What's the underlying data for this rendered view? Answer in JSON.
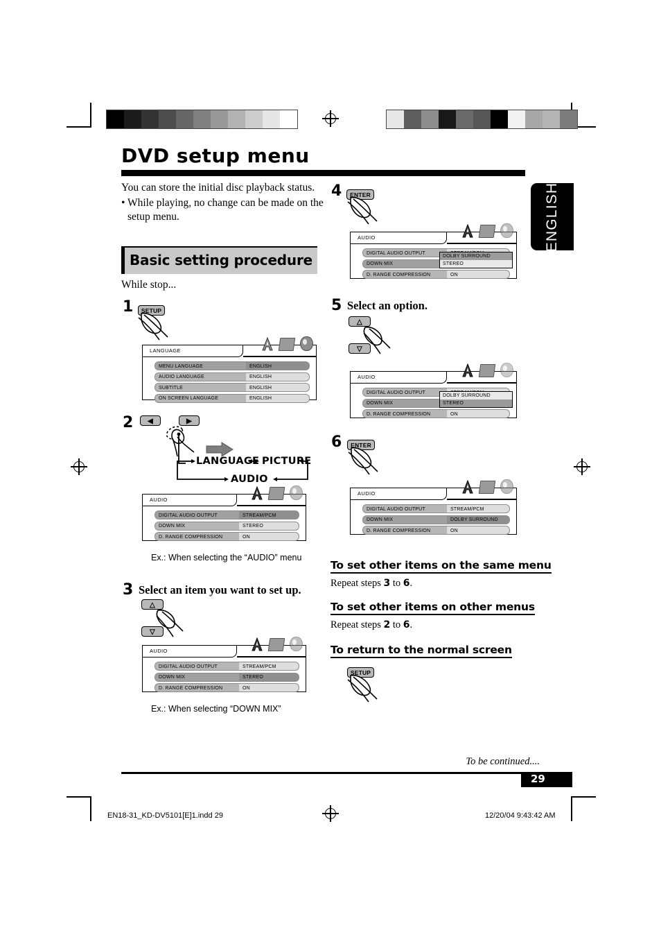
{
  "header": {
    "title": "DVD setup menu",
    "side_tab": "ENGLISH"
  },
  "intro": {
    "line1": "You can store the initial disc playback status.",
    "bullet_dot": "•",
    "bullet": "While playing, no change can be made on the setup menu."
  },
  "section": {
    "title": "Basic setting procedure",
    "while_stop": "While stop..."
  },
  "steps": {
    "s1": {
      "num": "1",
      "key": "SETUP"
    },
    "s2": {
      "num": "2",
      "key_left": "◀",
      "key_right": "▶"
    },
    "s3": {
      "num": "3",
      "heading": "Select an item you want to set up.",
      "key_up": "△",
      "key_down": "▽"
    },
    "s4": {
      "num": "4",
      "key": "ENTER"
    },
    "s5": {
      "num": "5",
      "heading": "Select an option.",
      "key_up": "△",
      "key_down": "▽"
    },
    "s6": {
      "num": "6",
      "key": "ENTER"
    }
  },
  "cycle": {
    "language": "LANGUAGE",
    "picture": "PICTURE",
    "audio": "AUDIO"
  },
  "captions": {
    "audio_menu": "Ex.: When selecting the “AUDIO” menu",
    "down_mix": "Ex.: When selecting “DOWN MIX”"
  },
  "osd_icons": {
    "language": "letter-a-icon",
    "picture": "screen-icon",
    "audio": "disc-icon"
  },
  "osd": {
    "language_screen": {
      "title": "LANGUAGE",
      "rows": [
        {
          "key": "MENU LANGUAGE",
          "value": "ENGLISH",
          "selected": true
        },
        {
          "key": "AUDIO LANGUAGE",
          "value": "ENGLISH",
          "selected": false
        },
        {
          "key": "SUBTITLE",
          "value": "ENGLISH",
          "selected": false
        },
        {
          "key": "ON SCREEN LANGUAGE",
          "value": "ENGLISH",
          "selected": false
        }
      ]
    },
    "audio_step2": {
      "title": "AUDIO",
      "rows": [
        {
          "key": "DIGITAL AUDIO OUTPUT",
          "value": "STREAM/PCM",
          "selected": true
        },
        {
          "key": "DOWN MIX",
          "value": "STEREO",
          "selected": false
        },
        {
          "key": "D. RANGE COMPRESSION",
          "value": "ON",
          "selected": false
        }
      ]
    },
    "audio_step3": {
      "title": "AUDIO",
      "rows": [
        {
          "key": "DIGITAL AUDIO OUTPUT",
          "value": "STREAM/PCM",
          "selected": false
        },
        {
          "key": "DOWN MIX",
          "value": "STEREO",
          "selected": true
        },
        {
          "key": "D. RANGE COMPRESSION",
          "value": "ON",
          "selected": false
        }
      ]
    },
    "audio_step4": {
      "title": "AUDIO",
      "rows": [
        {
          "key": "DIGITAL AUDIO OUTPUT",
          "value": "STREAM/PCM",
          "selected": false
        },
        {
          "key": "DOWN MIX",
          "value": "STEREO",
          "selected": true
        },
        {
          "key": "D. RANGE COMPRESSION",
          "value": "ON",
          "selected": false
        }
      ],
      "dropdown": {
        "option1": "DOLBY SURROUND",
        "option2": "STEREO",
        "highlighted": "STEREO"
      }
    },
    "audio_step5": {
      "title": "AUDIO",
      "rows": [
        {
          "key": "DIGITAL AUDIO OUTPUT",
          "value": "STREAM/PCM",
          "selected": false
        },
        {
          "key": "DOWN MIX",
          "value": "STEREO",
          "selected": true
        },
        {
          "key": "D. RANGE COMPRESSION",
          "value": "ON",
          "selected": false
        }
      ],
      "dropdown": {
        "option1": "DOLBY SURROUND",
        "option2": "STEREO",
        "highlighted": "DOLBY SURROUND"
      }
    },
    "audio_step6": {
      "title": "AUDIO",
      "rows": [
        {
          "key": "DIGITAL AUDIO OUTPUT",
          "value": "STREAM/PCM",
          "selected": false
        },
        {
          "key": "DOWN MIX",
          "value": "DOLBY SURROUND",
          "selected": true
        },
        {
          "key": "D. RANGE COMPRESSION",
          "value": "ON",
          "selected": false
        }
      ]
    }
  },
  "subsections": {
    "same_menu": {
      "heading": "To set other items on the same menu",
      "text_pre": "Repeat steps ",
      "from": "3",
      "mid": " to ",
      "to": "6",
      "end": "."
    },
    "other_menus": {
      "heading": "To set other items on other menus",
      "text_pre": "Repeat steps ",
      "from": "2",
      "mid": " to ",
      "to": "6",
      "end": "."
    },
    "return_normal": {
      "heading": "To return to the normal screen",
      "key": "SETUP"
    }
  },
  "footer": {
    "to_be_continued": "To be continued....",
    "page_number": "29",
    "file_name": "EN18-31_KD-DV5101[E]1.indd   29",
    "timestamp": "12/20/04   9:43:42 AM"
  }
}
